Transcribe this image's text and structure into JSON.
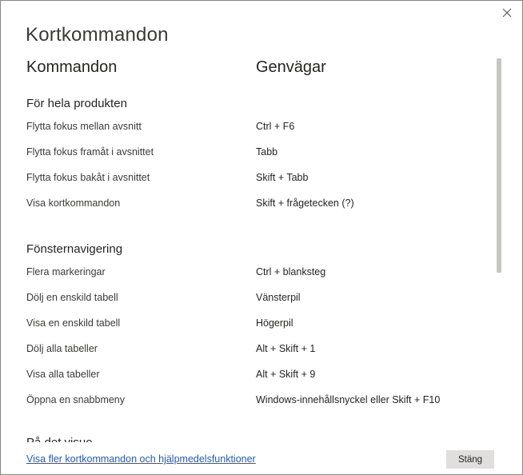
{
  "dialog": {
    "title": "Kortkommandon",
    "close_icon": "close-icon"
  },
  "columns": {
    "commands_header": "Kommandon",
    "shortcuts_header": "Genvägar"
  },
  "sections": [
    {
      "title": "För hela produkten",
      "rows": [
        {
          "command": "Flytta fokus mellan avsnitt",
          "shortcut": "Ctrl + F6"
        },
        {
          "command": "Flytta fokus framåt i avsnittet",
          "shortcut": "Tabb"
        },
        {
          "command": "Flytta fokus bakåt i avsnittet",
          "shortcut": "Skift + Tabb"
        },
        {
          "command": "Visa kortkommandon",
          "shortcut": "Skift + frågetecken (?)"
        }
      ]
    },
    {
      "title": "Fönsternavigering",
      "rows": [
        {
          "command": "Flera markeringar",
          "shortcut": "Ctrl + blanksteg"
        },
        {
          "command": "Dölj en enskild tabell",
          "shortcut": "Vänsterpil"
        },
        {
          "command": "Visa en enskild tabell",
          "shortcut": "Högerpil"
        },
        {
          "command": "Dölj alla tabeller",
          "shortcut": "Alt + Skift + 1"
        },
        {
          "command": "Visa alla tabeller",
          "shortcut": "Alt + Skift + 9"
        },
        {
          "command": "Öppna en snabbmeny",
          "shortcut": "Windows-innehållsnyckel eller Skift + F10"
        }
      ]
    },
    {
      "title": "På det visuo",
      "rows": []
    }
  ],
  "footer": {
    "link_text": "Visa fler kortkommandon och hjälpmedelsfunktioner",
    "close_button_label": "Stäng"
  }
}
